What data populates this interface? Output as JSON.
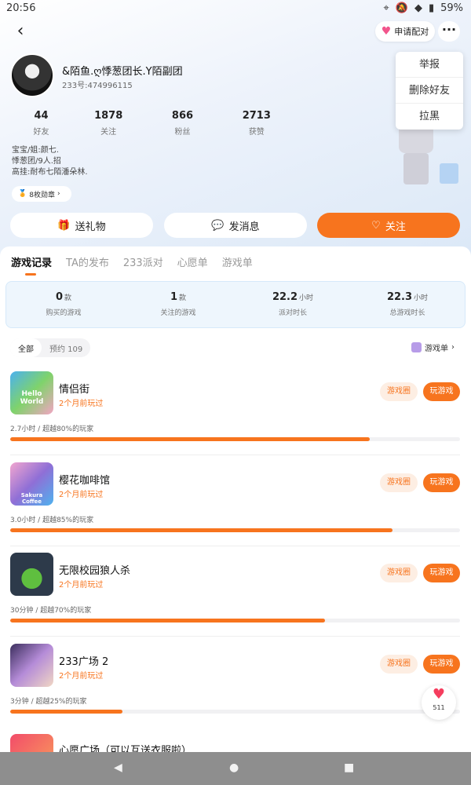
{
  "status": {
    "time": "20:56",
    "battery": "59%"
  },
  "header": {
    "match_label": "申请配对",
    "menu": [
      "举报",
      "删除好友",
      "拉黑"
    ]
  },
  "profile": {
    "nickname": "&陌鱼.ღ悸葱团长.Y陌副团",
    "uid": "233号:474996115",
    "stats": [
      {
        "value": "44",
        "label": "好友"
      },
      {
        "value": "1878",
        "label": "关注"
      },
      {
        "value": "866",
        "label": "粉丝"
      },
      {
        "value": "2713",
        "label": "获赞"
      }
    ],
    "bio": [
      "宝宝/姐:颜七.",
      "悸葱团/9人.招",
      "高挂:耐布七陌潘朵林."
    ],
    "badge": "8枚勋章"
  },
  "actions": {
    "gift": "送礼物",
    "message": "发消息",
    "follow": "关注"
  },
  "tabs": [
    "游戏记录",
    "TA的发布",
    "233派对",
    "心愿单",
    "游戏单"
  ],
  "summary": [
    {
      "value": "0",
      "unit": "款",
      "label": "购买的游戏"
    },
    {
      "value": "1",
      "unit": "款",
      "label": "关注的游戏"
    },
    {
      "value": "22.2",
      "unit": "小时",
      "label": "派对时长"
    },
    {
      "value": "22.3",
      "unit": "小时",
      "label": "总游戏时长"
    }
  ],
  "filter": {
    "all": "全部",
    "reserve": "预约 109",
    "gamelist": "游戏单"
  },
  "games": [
    {
      "name": "情侣街",
      "when": "2个月前玩过",
      "meta": "2.7小时 / 超越80%的玩家",
      "progress": 0.8,
      "circle": "游戏圈",
      "play": "玩游戏",
      "icon_text": "Hello World"
    },
    {
      "name": "樱花咖啡馆",
      "when": "2个月前玩过",
      "meta": "3.0小时 / 超越85%的玩家",
      "progress": 0.85,
      "circle": "游戏圈",
      "play": "玩游戏",
      "icon_text": "Sakura Coffee"
    },
    {
      "name": "无限校园狼人杀",
      "when": "2个月前玩过",
      "meta": "30分钟 / 超越70%的玩家",
      "progress": 0.7,
      "circle": "游戏圈",
      "play": "玩游戏",
      "icon_text": ""
    },
    {
      "name": "233广场 2",
      "when": "2个月前玩过",
      "meta": "3分钟 / 超越25%的玩家",
      "progress": 0.25,
      "circle": "游戏圈",
      "play": "玩游戏",
      "icon_text": ""
    },
    {
      "name": "心愿广场（可以互送衣服啦）",
      "when": "",
      "meta": "",
      "progress": 0,
      "circle": "",
      "play": "",
      "icon_text": ""
    }
  ],
  "like": {
    "count": "511"
  },
  "colors": {
    "accent": "#f7741e",
    "like": "#f53d5e"
  }
}
